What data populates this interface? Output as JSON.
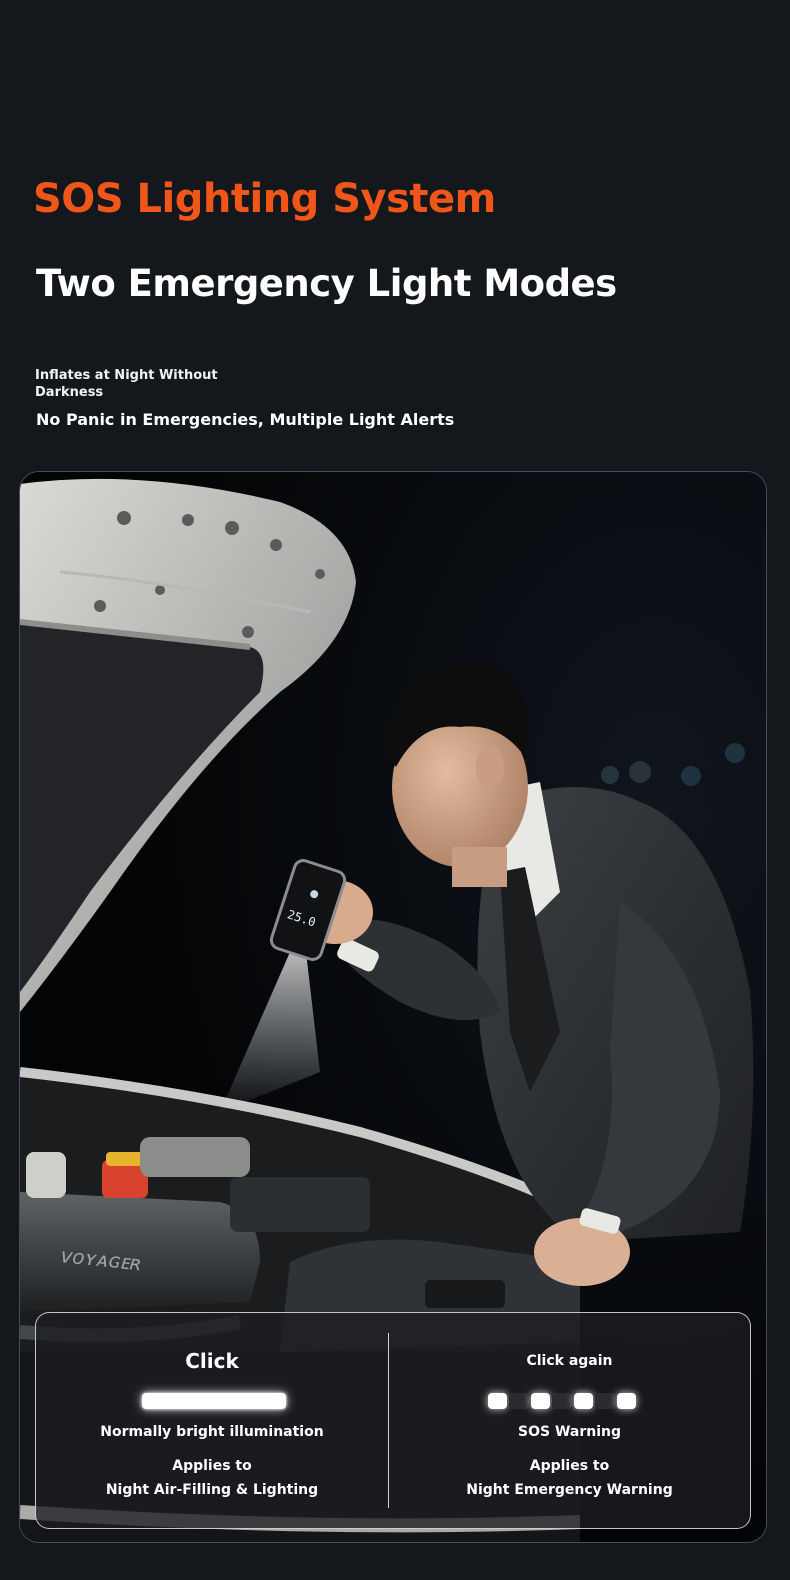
{
  "header": {
    "title": "SOS Lighting System",
    "subtitle": "Two Emergency Light Modes",
    "note_small": "Inflates at Night Without Darkness",
    "note_main": "No Panic in Emergencies, Multiple Light Alerts"
  },
  "modes": [
    {
      "action": "Click",
      "light_pattern": "steady",
      "label": "Normally bright illumination",
      "applies_label": "Applies to",
      "use_case": "Night Air-Filling & Lighting"
    },
    {
      "action": "Click again",
      "light_pattern": "flashing",
      "label": "SOS Warning",
      "applies_label": "Applies to",
      "use_case": "Night Emergency Warning"
    }
  ],
  "colors": {
    "background": "#14171c",
    "accent": "#f0561a",
    "text": "#ffffff"
  }
}
